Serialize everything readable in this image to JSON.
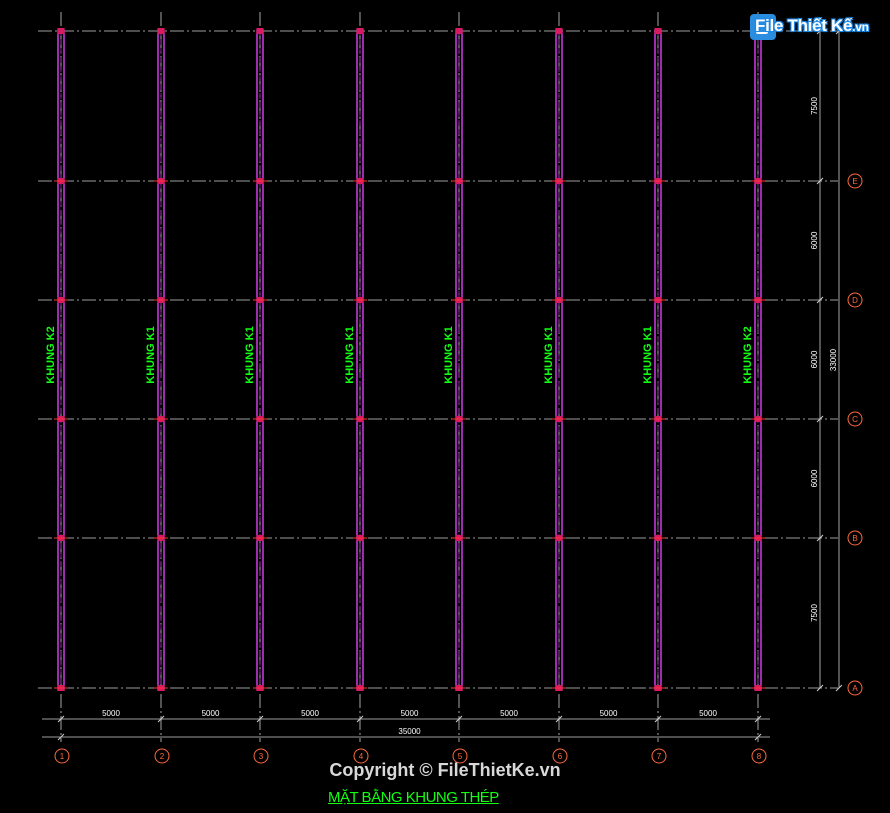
{
  "logo": {
    "text": "File Thiết Kế",
    "suffix": ".vn"
  },
  "copyright": "Copyright © FileThietKe.vn",
  "drawing_title": "MẶT BẰNG KHUNG THÉP",
  "frames": [
    "KHUNG K2",
    "KHUNG K1",
    "KHUNG K1",
    "KHUNG K1",
    "KHUNG K1",
    "KHUNG K1",
    "KHUNG K1",
    "KHUNG K2"
  ],
  "axes_numbers": [
    "1",
    "2",
    "3",
    "4",
    "5",
    "6",
    "7",
    "8"
  ],
  "axes_letters": [
    "E",
    "D",
    "C",
    "B",
    "A"
  ],
  "bay_spacings": [
    "5000",
    "5000",
    "5000",
    "5000",
    "5000",
    "5000",
    "5000"
  ],
  "total_length": "35000",
  "row_spacings": [
    "7500",
    "6000",
    "6000",
    "6000",
    "7500"
  ],
  "total_width": "33000",
  "colors": {
    "frame": "#e040fb",
    "frame_inner": "#9c27b0",
    "label": "#12ff12",
    "grid": "#cfcfcf",
    "bubble": "#ff6a3d",
    "dim": "#d0d0d0",
    "text": "#ffffff"
  }
}
